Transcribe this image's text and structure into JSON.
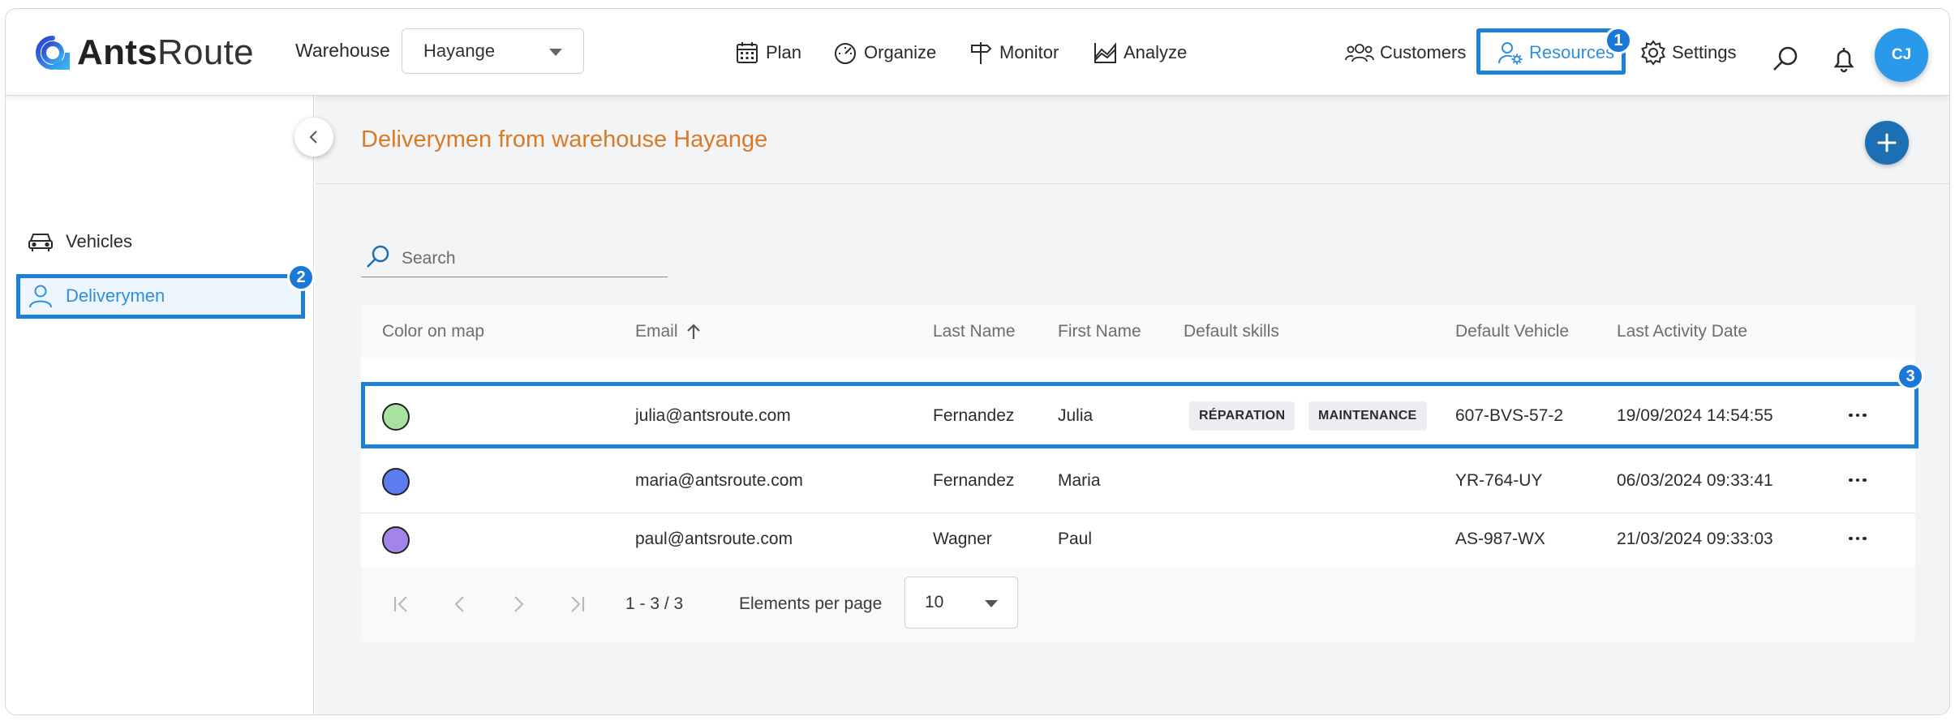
{
  "brand": {
    "name_bold": "Ants",
    "name_light": "Route"
  },
  "warehouse": {
    "label": "Warehouse",
    "selected": "Hayange"
  },
  "nav": {
    "plan": "Plan",
    "organize": "Organize",
    "monitor": "Monitor",
    "analyze": "Analyze",
    "customers": "Customers",
    "resources": "Resources",
    "settings": "Settings"
  },
  "user": {
    "initials": "CJ"
  },
  "badges": {
    "one": "1",
    "two": "2",
    "three": "3"
  },
  "sidebar": {
    "items": [
      {
        "label": "Vehicles",
        "icon": "car-icon"
      },
      {
        "label": "Deliverymen",
        "icon": "person-icon"
      }
    ]
  },
  "page": {
    "title": "Deliverymen from warehouse Hayange"
  },
  "search": {
    "placeholder": "Search",
    "value": ""
  },
  "table": {
    "columns": [
      "Color on map",
      "Email",
      "Last Name",
      "First Name",
      "Default skills",
      "Default Vehicle",
      "Last Activity Date"
    ],
    "rows": [
      {
        "color": "#a8e2a2",
        "email": "julia@antsroute.com",
        "last_name": "Fernandez",
        "first_name": "Julia",
        "skills": [
          "RÉPARATION",
          "MAINTENANCE"
        ],
        "vehicle": "607-BVS-57-2",
        "last_activity": "19/09/2024 14:54:55"
      },
      {
        "color": "#5b7df0",
        "email": "maria@antsroute.com",
        "last_name": "Fernandez",
        "first_name": "Maria",
        "skills": [],
        "vehicle": "YR-764-UY",
        "last_activity": "06/03/2024 09:33:41"
      },
      {
        "color": "#a484ea",
        "email": "paul@antsroute.com",
        "last_name": "Wagner",
        "first_name": "Paul",
        "skills": [],
        "vehicle": "AS-987-WX",
        "last_activity": "21/03/2024 09:33:03"
      }
    ]
  },
  "pagination": {
    "range": "1 - 3 / 3",
    "per_page_label": "Elements per page",
    "per_page": "10"
  },
  "colors": {
    "accent": "#1e7fd9",
    "title": "#d97a28",
    "primary_button": "#1c6fb2"
  }
}
